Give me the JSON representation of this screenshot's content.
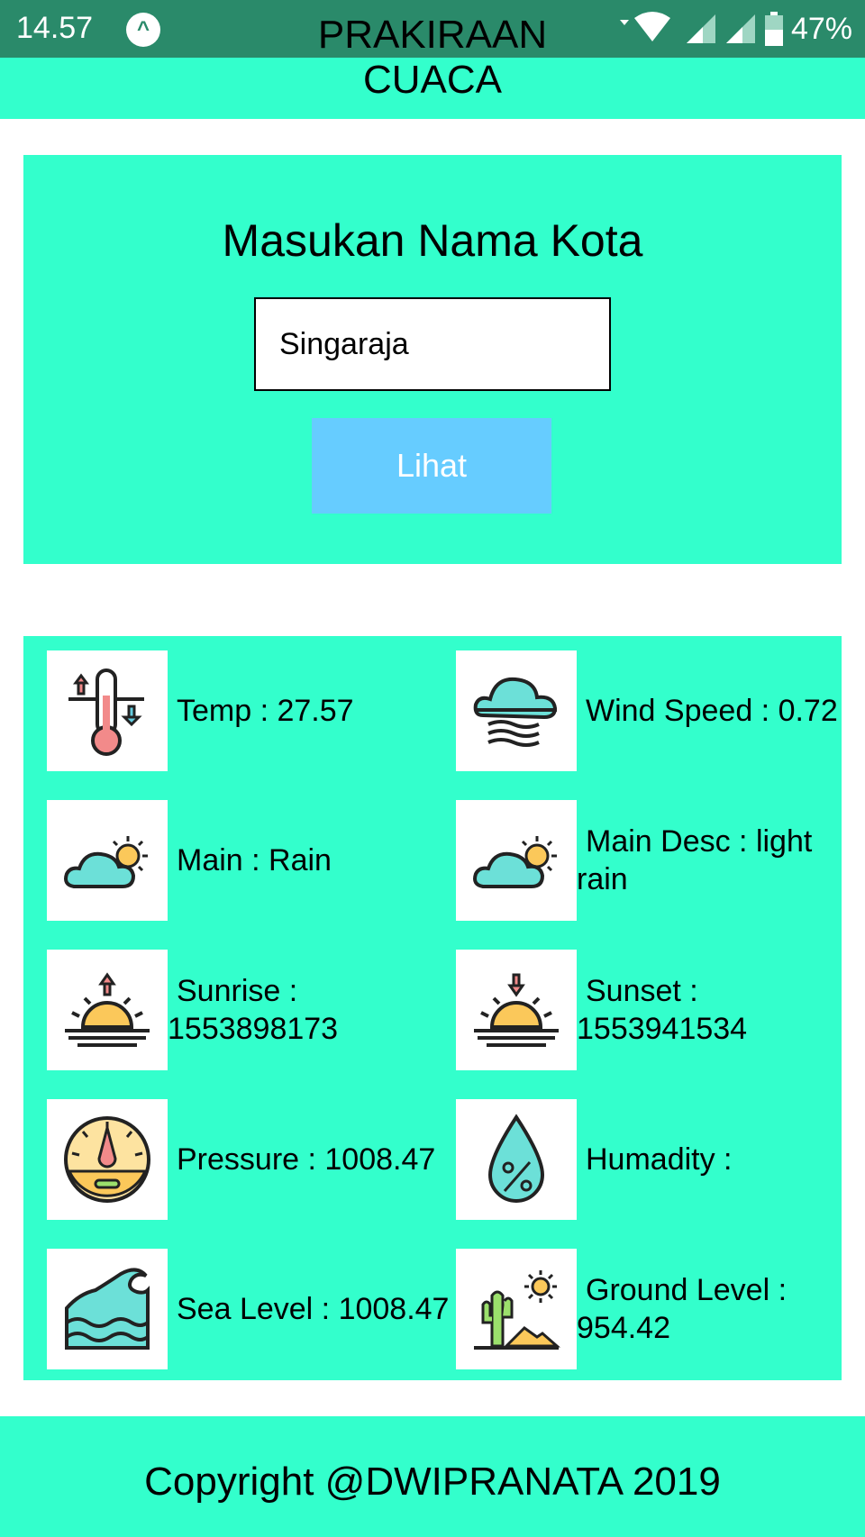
{
  "status_bar": {
    "time": "14.57",
    "battery": "47%"
  },
  "app_bar": {
    "title": "PRAKIRAAN CUACA"
  },
  "search": {
    "title": "Masukan Nama Kota",
    "city_value": "Singaraja",
    "button_label": "Lihat"
  },
  "weather": {
    "temp": "Temp : 27.57",
    "wind_speed": "Wind Speed : 0.72",
    "main": "Main : Rain",
    "main_desc": "Main Desc : light rain",
    "sunrise": "Sunrise : 1553898173",
    "sunset": "Sunset : 1553941534",
    "pressure": "Pressure : 1008.47",
    "humidity": "Humadity :",
    "sea_level": "Sea Level : 1008.47",
    "ground_level": "Ground Level : 954.42"
  },
  "footer": {
    "copyright": "Copyright @DWIPRANATA 2019"
  },
  "colors": {
    "accent": "#33ffcc",
    "status_bar": "#2a8a6a",
    "button": "#66ccff"
  }
}
